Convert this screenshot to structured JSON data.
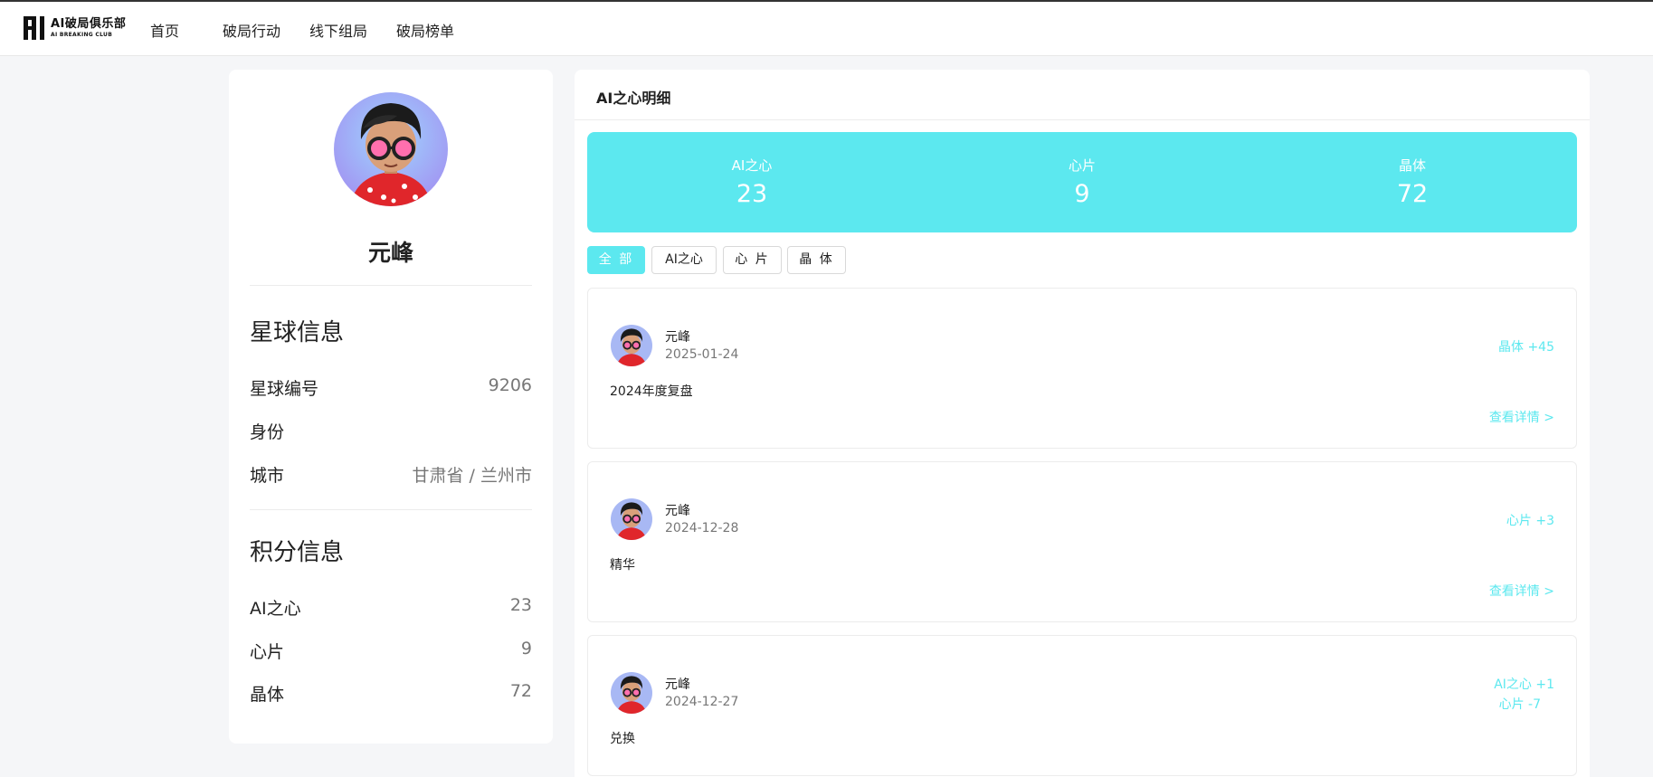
{
  "header": {
    "logo_cn": "AI破局俱乐部",
    "logo_en": "AI BREAKING CLUB",
    "nav": [
      "首页",
      "破局行动",
      "线下组局",
      "破局榜单"
    ]
  },
  "profile": {
    "name": "元峰",
    "planet_section": "星球信息",
    "planet_rows": [
      {
        "label": "星球编号",
        "value": "9206"
      },
      {
        "label": "身份",
        "value": ""
      },
      {
        "label": "城市",
        "value": "甘肃省 / 兰州市"
      }
    ],
    "points_section": "积分信息",
    "points_rows": [
      {
        "label": "AI之心",
        "value": "23"
      },
      {
        "label": "心片",
        "value": "9"
      },
      {
        "label": "晶体",
        "value": "72"
      }
    ]
  },
  "detail": {
    "title": "AI之心明细",
    "stats": [
      {
        "label": "AI之心",
        "value": "23"
      },
      {
        "label": "心片",
        "value": "9"
      },
      {
        "label": "晶体",
        "value": "72"
      }
    ],
    "filters": [
      "全 部",
      "AI之心",
      "心 片",
      "晶 体"
    ],
    "active_filter": "全 部",
    "records": [
      {
        "name": "元峰",
        "date": "2025-01-24",
        "delta": "晶体 +45",
        "delta2": "",
        "desc": "2024年度复盘",
        "link": "查看详情 >"
      },
      {
        "name": "元峰",
        "date": "2024-12-28",
        "delta": "心片 +3",
        "delta2": "",
        "desc": "精华",
        "link": "查看详情 >"
      },
      {
        "name": "元峰",
        "date": "2024-12-27",
        "delta": "AI之心 +1",
        "delta2": "心片 -7",
        "desc": "兑换",
        "link": ""
      }
    ]
  },
  "colors": {
    "accent": "#5ce8ef",
    "background": "#f5f6f8",
    "text": "#222222",
    "muted": "#777777"
  }
}
